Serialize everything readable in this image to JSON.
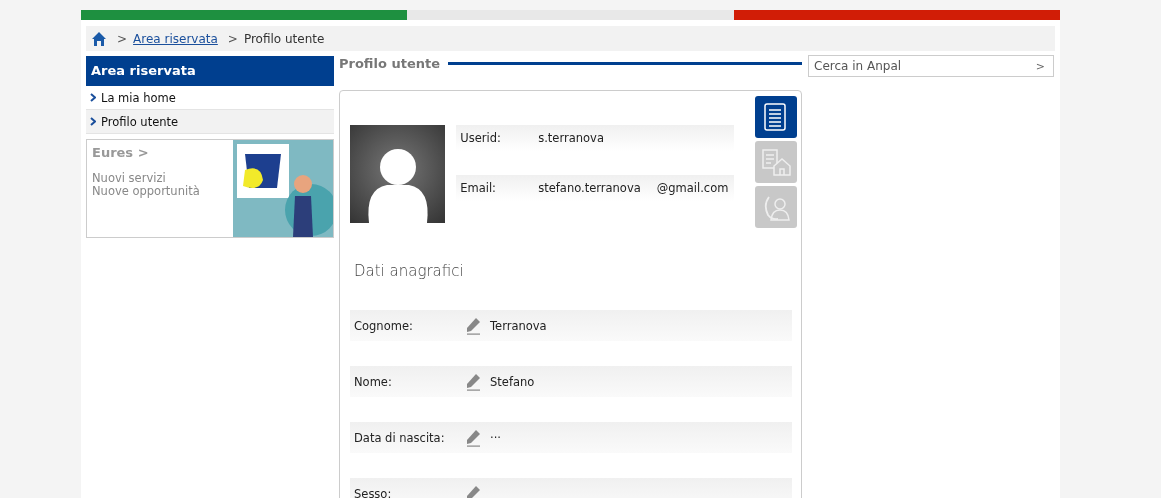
{
  "breadcrumb": {
    "items": [
      {
        "separator": ">",
        "label": "Area riservata",
        "kind": "link"
      },
      {
        "separator": ">",
        "label": "Profilo utente",
        "kind": "current"
      }
    ]
  },
  "sidebar": {
    "title": "Area riservata",
    "items": [
      {
        "label": "La mia home",
        "selected": false
      },
      {
        "label": "Profilo utente",
        "selected": true
      }
    ],
    "promo": {
      "title": "Eures >",
      "lines": [
        "Nuovi servizi",
        "Nuove opportunità"
      ]
    }
  },
  "main": {
    "title": "Profilo utente",
    "account": [
      {
        "label": "Userid:",
        "value": "s.terranova"
      },
      {
        "label": "Email:",
        "value": "stefano.terranova",
        "value_suffix": "@gmail.com"
      }
    ],
    "side_tabs": [
      {
        "kind": "document",
        "selected": true
      },
      {
        "kind": "address",
        "selected": false
      },
      {
        "kind": "contact",
        "selected": false
      }
    ],
    "section_title": "Dati anagrafici",
    "fields": [
      {
        "label": "Cognome:",
        "value": "Terranova"
      },
      {
        "label": "Nome:",
        "value": "Stefano"
      },
      {
        "label": "Data di nascita:",
        "value": "···"
      },
      {
        "label": "Sesso:"
      }
    ]
  },
  "search": {
    "placeholder": "Cerca in Anpal",
    "button": ">"
  }
}
